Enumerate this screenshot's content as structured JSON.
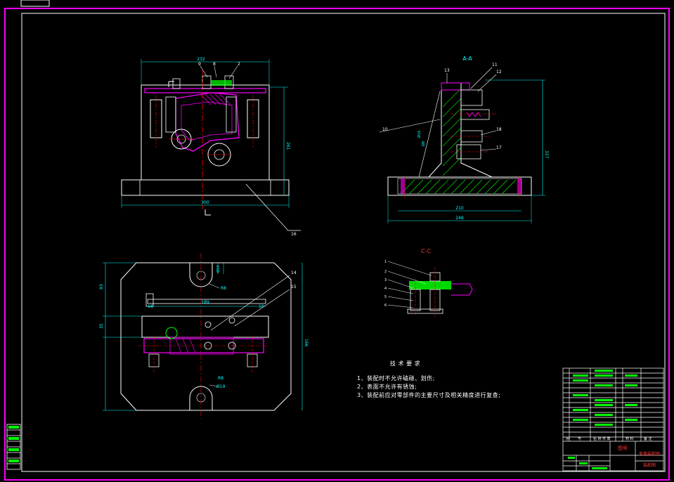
{
  "colors": {
    "background": "#000000",
    "frame": "#ff00ff",
    "outline": "#ffffff",
    "dimension": "#00ffff",
    "centerline": "#ff0000",
    "hatch": "#00ff00",
    "part_magenta": "#ff00ff",
    "label_red": "#ff3333"
  },
  "views": {
    "front": {
      "dims": [
        "232",
        "261",
        "300"
      ],
      "balloons": [
        "9",
        "8",
        "2"
      ],
      "leader_label": "16"
    },
    "section_aa": {
      "title": "A-A",
      "dims": [
        "210",
        "248",
        "327"
      ],
      "balloons": [
        "13",
        "11",
        "12",
        "10",
        "18",
        "17"
      ],
      "small_dims": [
        "Ø16",
        "Ø8"
      ]
    },
    "top": {
      "dims": [
        "93",
        "189",
        "35",
        "166",
        "R8",
        "R8",
        "Ø19",
        "Ø19",
        "16",
        "10"
      ],
      "balloons": [
        "14",
        "15"
      ]
    },
    "section_cc": {
      "title": "C-C",
      "balloons": [
        "1",
        "2",
        "3",
        "4",
        "5",
        "6"
      ]
    }
  },
  "tech_requirements": {
    "heading": "技 术 要 求",
    "items": [
      "1、装配时不允许磕碰、划伤;",
      "2、表面不允许有锈蚀;",
      "3、装配前应对零部件的主要尺寸及相关精度进行复查;"
    ]
  },
  "title_block": {
    "header_cols": [
      "序",
      "号",
      "名 称 件 数",
      "材 料",
      "备 注"
    ],
    "drawing_name": "图号",
    "subtitle": "夹具装配图",
    "part_name": "装配图"
  },
  "window_stub": {
    "title": ""
  }
}
